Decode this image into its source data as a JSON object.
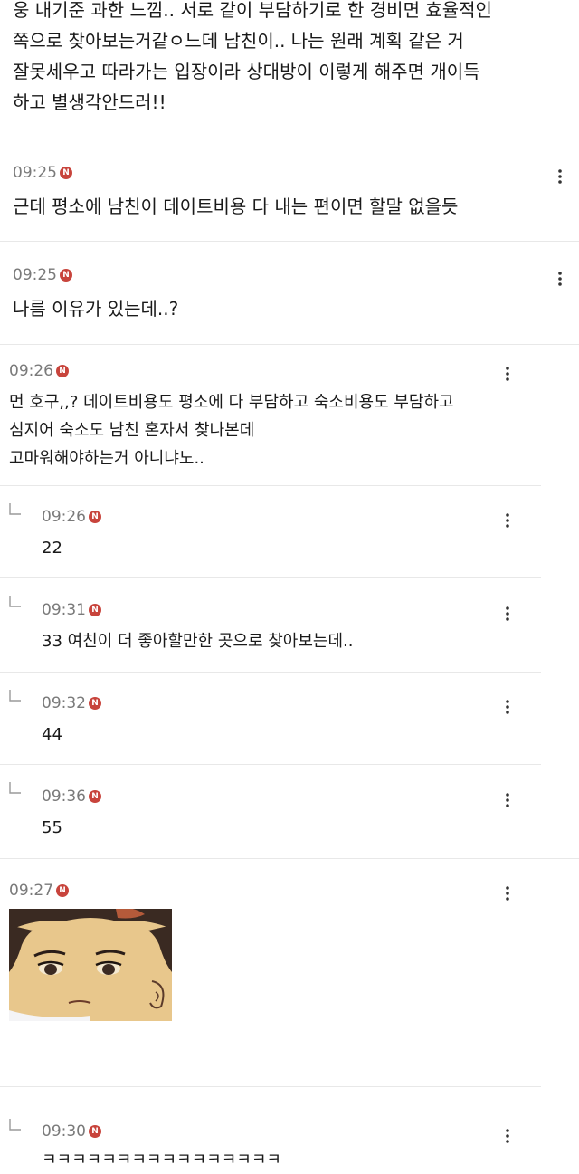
{
  "top_comment_text": "웅 내기준 과한 느낌.. 서로 같이 부담하기로 한 경비면 효율적인\n쪽으로 찾아보는거같ㅇ느데 남친이.. 나는 원래 계획 같은 거\n잘못세우고 따라가는 입장이라 상대방이 이렇게 해주면 개이득\n하고 별생각안드러!!",
  "comments": [
    {
      "time": "09:25",
      "text": "근데 평소에 남친이 데이트비용 다 내는 편이면 할말 없을듯"
    },
    {
      "time": "09:25",
      "text": "나름 이유가 있는데..?"
    },
    {
      "time": "09:26",
      "text": "먼 호구,,? 데이트비용도 평소에 다 부담하고 숙소비용도 부담하고\n심지어 숙소도 남친 혼자서 찾나본데\n고마워해야하는거 아니냐노.."
    }
  ],
  "replies": [
    {
      "time": "09:26",
      "text": "22"
    },
    {
      "time": "09:31",
      "text": "33 여친이 더 좋아할만한 곳으로 찾아보는데.."
    },
    {
      "time": "09:32",
      "text": "44"
    },
    {
      "time": "09:36",
      "text": "55"
    }
  ],
  "image_comment": {
    "time": "09:27",
    "image": "cartoon-character-face"
  },
  "last_reply": {
    "time": "09:30",
    "text": "ㅋㅋㅋㅋㅋㅋㅋㅋㅋㅋㅋㅋㅋㅋㅋㅋ"
  },
  "badge_letter": "N",
  "colors": {
    "badge": "#c8443c",
    "timestamp": "#7a7a7a",
    "divider": "#e8e8e8"
  }
}
